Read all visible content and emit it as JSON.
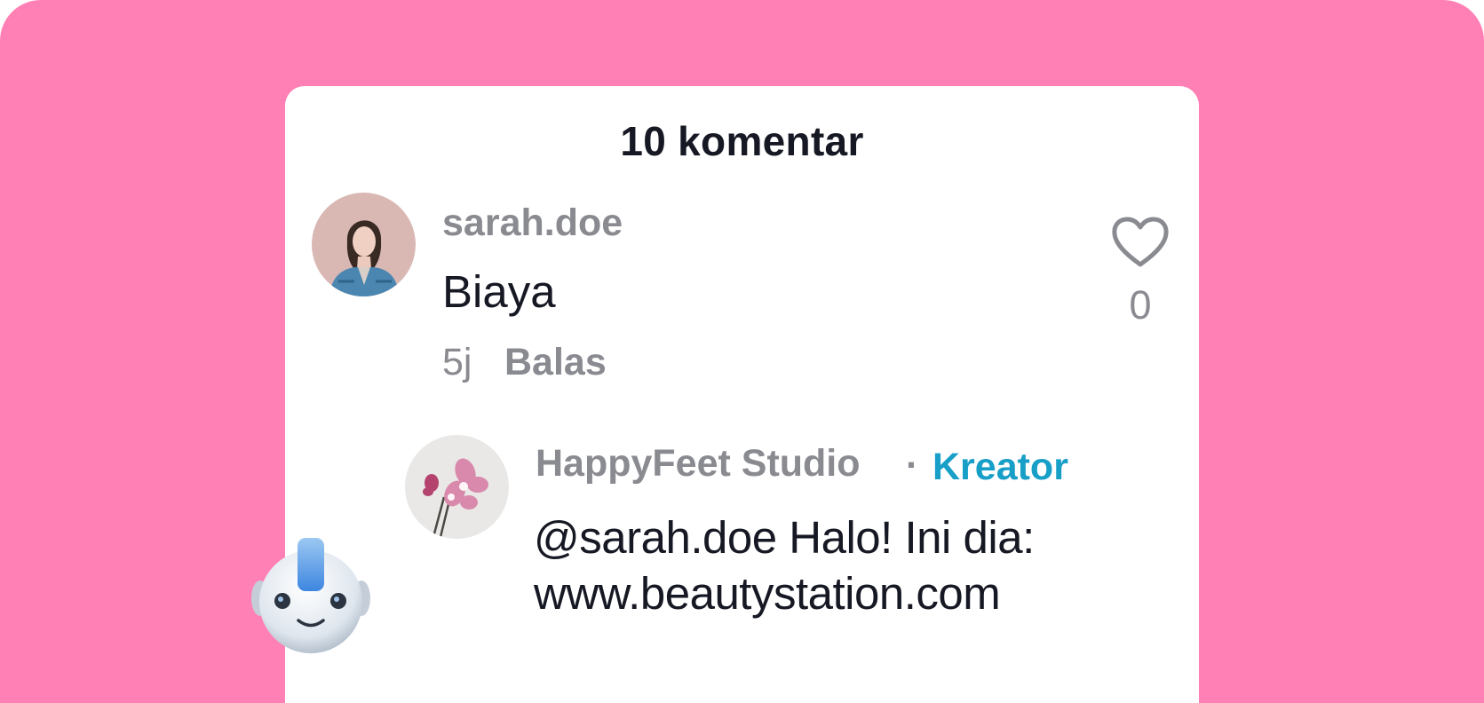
{
  "header": {
    "title": "10 komentar"
  },
  "comments": [
    {
      "username": "sarah.doe",
      "text": "Biaya",
      "time": "5j",
      "reply_label": "Balas",
      "likes": "0",
      "avatar_icon": "woman-portrait-avatar",
      "replies": [
        {
          "username": "HappyFeet Studio",
          "separator": "·",
          "badge": "Kreator",
          "text_lines": [
            "@sarah.doe Halo! Ini dia:",
            "www.beautystation.com"
          ],
          "avatar_icon": "orchid-flower-avatar"
        }
      ]
    }
  ],
  "icons": {
    "like": "heart-outline-icon",
    "assistant": "robot-assistant-icon"
  },
  "colors": {
    "background": "#ff80b5",
    "sheet": "#ffffff",
    "primary_text": "#161823",
    "secondary_text": "#8a8b91",
    "creator_badge": "#179fc8"
  }
}
